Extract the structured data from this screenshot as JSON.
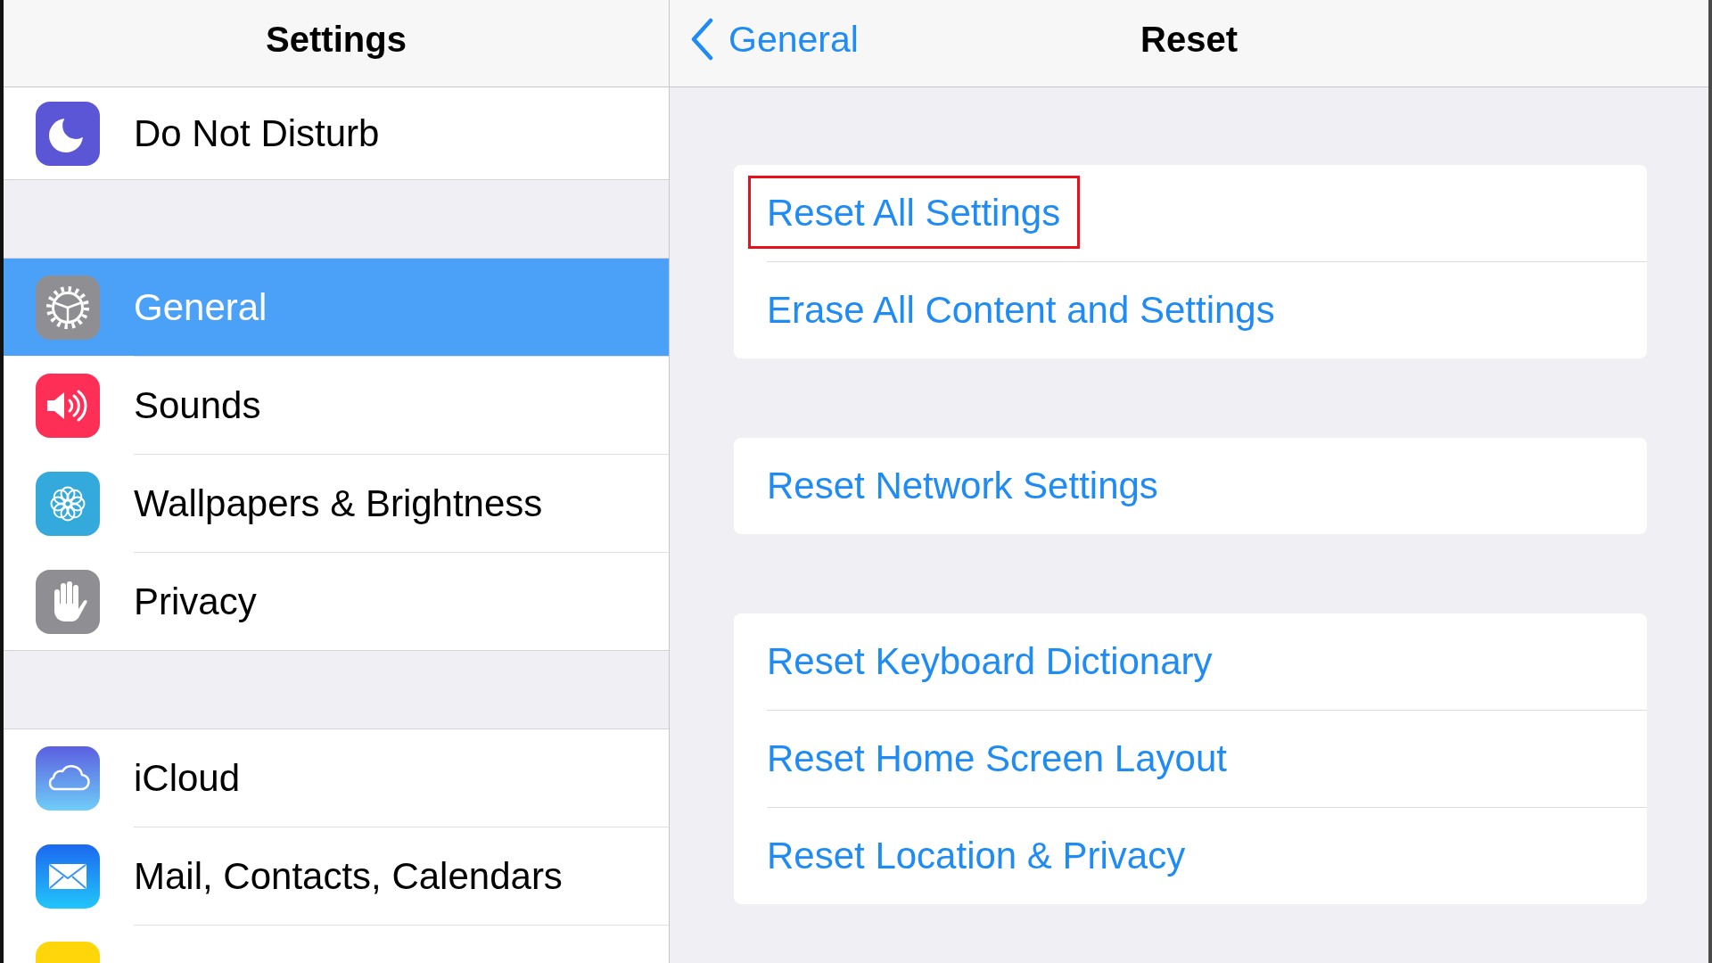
{
  "sidebar": {
    "title": "Settings",
    "groups": [
      {
        "items": [
          {
            "kind": "row",
            "label": "Do Not Disturb",
            "selected": false
          }
        ]
      },
      {
        "items": [
          {
            "kind": "row",
            "label": "General",
            "selected": true
          },
          {
            "kind": "row",
            "label": "Sounds",
            "selected": false
          },
          {
            "kind": "row",
            "label": "Wallpapers & Brightness",
            "selected": false
          },
          {
            "kind": "row",
            "label": "Privacy",
            "selected": false
          }
        ]
      },
      {
        "items": [
          {
            "kind": "row",
            "label": "iCloud",
            "selected": false
          },
          {
            "kind": "row",
            "label": "Mail, Contacts, Calendars",
            "selected": false
          },
          {
            "kind": "cut-off",
            "selected": false
          }
        ]
      }
    ]
  },
  "detail": {
    "back_label": "General",
    "title": "Reset",
    "groups": [
      {
        "rows": [
          {
            "label": "Reset All Settings",
            "highlighted": true
          },
          {
            "label": "Erase All Content and Settings",
            "highlighted": false
          }
        ]
      },
      {
        "rows": [
          {
            "label": "Reset Network Settings",
            "highlighted": false
          }
        ]
      },
      {
        "rows": [
          {
            "label": "Reset Keyboard Dictionary",
            "highlighted": false
          },
          {
            "label": "Reset Home Screen Layout",
            "highlighted": false
          },
          {
            "label": "Reset Location & Privacy",
            "highlighted": false
          }
        ]
      }
    ]
  }
}
